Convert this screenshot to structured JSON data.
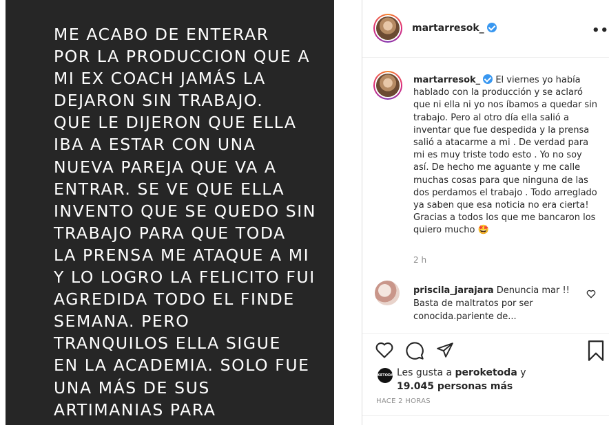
{
  "story": {
    "text": "ME ACABO DE ENTERAR\nPOR LA PRODUCCION QUE A\nMI EX COACH JAMÁS LA\nDEJARON SIN TRABAJO.\nQUE LE DIJERON QUE ELLA\nIBA A ESTAR CON UNA\nNUEVA PAREJA QUE VA A\nENTRAR. SE VE QUE ELLA\nINVENTO QUE SE QUEDO SIN\nTRABAJO PARA QUE TODA\nLA PRENSA ME ATAQUE A MI\nY LO LOGRO LA FELICITO FUI\nAGREDIDA TODO EL FINDE\nSEMANA. PERO\nTRANQUILOS ELLA SIGUE\nEN LA ACADEMIA. SOLO FUE\nUNA MÁS DE SUS\nARTIMANIAS PARA"
  },
  "header": {
    "username": "martarresok_",
    "more_icon": "more-horizontal-icon",
    "more_label": "•••"
  },
  "caption": {
    "username": "martarresok_",
    "text": "El viernes yo había hablado con la producción y se aclaró que ni ella ni yo nos íbamos a quedar sin trabajo. Pero al otro día ella salió a inventar que fue despedida y la prensa salió a atacarme a mi . De verdad para mi es muy triste todo esto . Yo no soy así. De hecho me aguante y me calle muchas cosas para que ninguna de las dos perdamos el trabajo . Todo arreglado ya saben que esa noticia no era cierta! Gracias a todos los que me bancaron los quiero mucho",
    "emoji": "🤩",
    "time": "2 h"
  },
  "comment": {
    "username": "priscila_jarajara",
    "text": "Denuncia mar !! Basta de maltratos por ser conocida.pariente de...",
    "like_icon": "heart-outline-icon"
  },
  "actions": {
    "icons": [
      "heart-icon",
      "comment-icon",
      "share-icon",
      "bookmark-icon"
    ]
  },
  "likes": {
    "avatar_label": "KETODA",
    "prefix": "Les gusta a ",
    "user": "peroketoda",
    "middle": " y",
    "count": "19.045 personas más"
  },
  "posted_ago": "HACE 2 HORAS",
  "colors": {
    "story_bg": "#262626",
    "verified": "#3897f0",
    "muted_text": "#8e8e8e"
  }
}
